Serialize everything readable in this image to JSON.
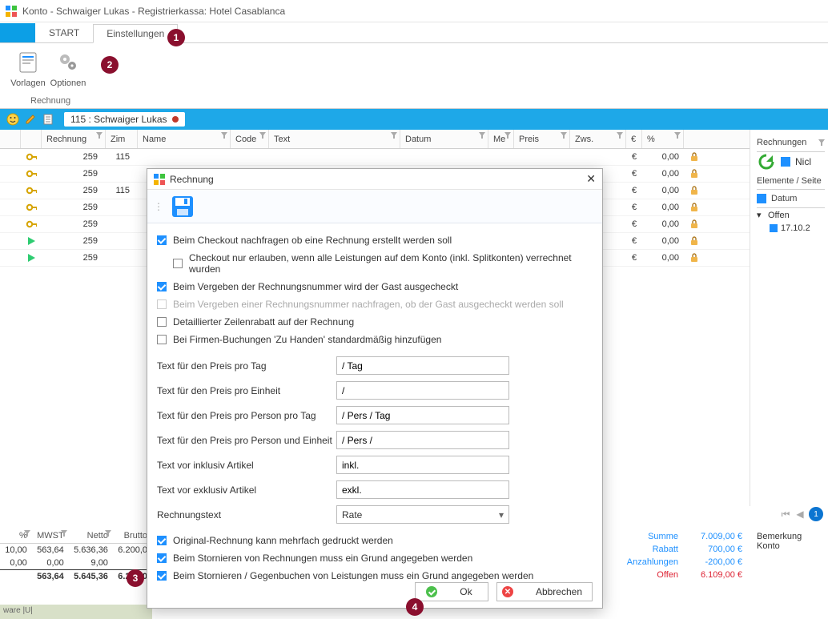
{
  "window": {
    "title": "Konto - Schwaiger Lukas - Registrierkassa: Hotel Casablanca"
  },
  "tabs": {
    "start": "START",
    "einstellungen": "Einstellungen"
  },
  "ribbon": {
    "vorlagen": "Vorlagen",
    "optionen": "Optionen",
    "group": "Rechnung"
  },
  "account": {
    "label": "115 :  Schwaiger Lukas"
  },
  "grid": {
    "headers": {
      "rechnung": "Rechnung",
      "zim": "Zim",
      "name": "Name",
      "code": "Code",
      "text": "Text",
      "datum": "Datum",
      "me": "Me",
      "preis": "Preis",
      "zws": "Zws.",
      "euro": "€",
      "pct": "%"
    },
    "rows": [
      {
        "type": "key",
        "rn": "259",
        "zim": "115",
        "pct": "0,00",
        "lock": true
      },
      {
        "type": "key",
        "rn": "259",
        "zim": "",
        "pct": "0,00",
        "lock": true
      },
      {
        "type": "key",
        "rn": "259",
        "zim": "115",
        "pct": "0,00",
        "lock": true
      },
      {
        "type": "key",
        "rn": "259",
        "zim": "",
        "pct": "0,00",
        "lock": true
      },
      {
        "type": "key",
        "rn": "259",
        "zim": "",
        "pct": "0,00",
        "lock": true
      },
      {
        "type": "play",
        "rn": "259",
        "zim": "",
        "pct": "0,00",
        "lock": true
      },
      {
        "type": "play",
        "rn": "259",
        "zim": "",
        "pct": "0,00",
        "lock": true
      }
    ]
  },
  "rightpanel": {
    "title": "Rechnungen",
    "nicht": "Nicl",
    "sub": "Elemente / Seite",
    "datum": "Datum",
    "offen": "Offen",
    "date": "17.10.2"
  },
  "summary": {
    "headers": {
      "pct": "%",
      "mwst": "MWST",
      "netto": "Netto",
      "brutto": "Brutto"
    },
    "rows": [
      {
        "pct": "10,00",
        "mwst": "563,64",
        "netto": "5.636,36",
        "brutto": "6.200,0"
      },
      {
        "pct": "0,00",
        "mwst": "0,00",
        "netto": "9,00",
        "brutto": ""
      }
    ],
    "totals": {
      "mwst": "563,64",
      "netto": "5.645,36",
      "brutto": "6.209,0"
    },
    "right": {
      "summe_l": "Summe",
      "summe_v": "7.009,00  €",
      "rabatt_l": "Rabatt",
      "rabatt_v": "700,00  €",
      "anz_l": "Anzahlungen",
      "anz_v": "-200,00  €",
      "offen_l": "Offen",
      "offen_v": "6.109,00  €"
    },
    "rcol": {
      "bemerkung": "Bemerkung",
      "konto": "Konto"
    }
  },
  "statusbar": "ware |U|",
  "dialog": {
    "title": "Rechnung",
    "checks": [
      {
        "label": "Beim Checkout nachfragen ob eine Rechnung erstellt werden soll",
        "checked": true
      },
      {
        "label": "Checkout nur erlauben, wenn alle Leistungen auf dem Konto (inkl. Splitkonten) verrechnet wurden",
        "checked": false,
        "indent": true
      },
      {
        "label": "Beim Vergeben der Rechnungsnummer wird der Gast ausgecheckt",
        "checked": true
      },
      {
        "label": "Beim Vergeben einer Rechnungsnummer nachfragen, ob der Gast ausgecheckt werden soll",
        "checked": false,
        "disabled": true
      },
      {
        "label": "Detaillierter Zeilenrabatt auf der Rechnung",
        "checked": false
      },
      {
        "label": "Bei Firmen-Buchungen 'Zu Handen' standardmäßig hinzufügen",
        "checked": false
      }
    ],
    "fields": [
      {
        "label": "Text für den Preis pro Tag",
        "value": "/ Tag"
      },
      {
        "label": "Text für den Preis pro Einheit",
        "value": "/"
      },
      {
        "label": "Text für den Preis pro Person pro Tag",
        "value": "/ Pers / Tag"
      },
      {
        "label": "Text für den Preis pro Person und Einheit",
        "value": "/ Pers /"
      },
      {
        "label": "Text vor inklusiv Artikel",
        "value": "inkl."
      },
      {
        "label": "Text vor exklusiv Artikel",
        "value": "exkl."
      }
    ],
    "combo": {
      "label": "Rechnungstext",
      "value": "Rate"
    },
    "checks2": [
      {
        "label": "Original-Rechnung kann mehrfach gedruckt werden",
        "checked": true
      },
      {
        "label": "Beim Stornieren von Rechnungen muss ein Grund angegeben werden",
        "checked": true
      },
      {
        "label": "Beim Stornieren / Gegenbuchen von Leistungen muss ein Grund angegeben werden",
        "checked": true
      }
    ],
    "ok": "Ok",
    "abbrechen": "Abbrechen"
  },
  "badges": {
    "b1": "1",
    "b2": "2",
    "b3": "3",
    "b4": "4",
    "pager": "1"
  }
}
